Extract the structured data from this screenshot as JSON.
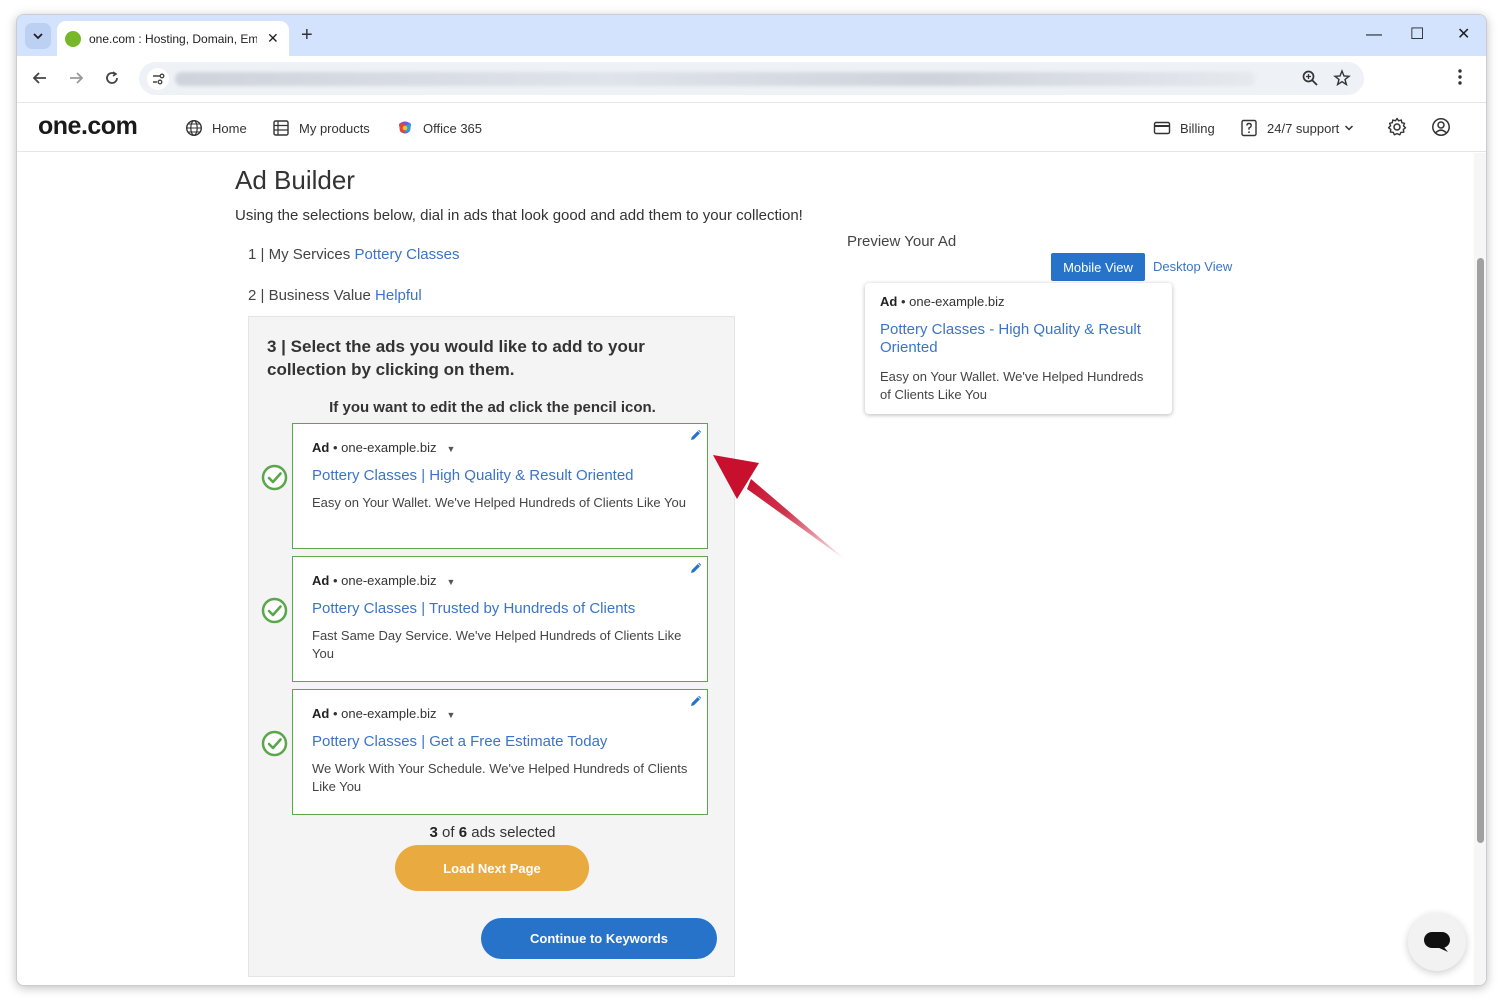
{
  "browser": {
    "tab_title": "one.com : Hosting, Domain, Em",
    "new_tab_glyph": "+",
    "close_glyph": "✕",
    "minimize_glyph": "—",
    "maximize_glyph": "☐",
    "window_close_glyph": "✕"
  },
  "site_header": {
    "logo": "one.com",
    "nav": [
      {
        "label": "Home",
        "icon": "globe-icon"
      },
      {
        "label": "My products",
        "icon": "list-icon"
      },
      {
        "label": "Office 365",
        "icon": "office-icon"
      }
    ],
    "billing_label": "Billing",
    "support_label": "24/7 support"
  },
  "page": {
    "title": "Ad Builder",
    "subtitle": "Using the selections below, dial in ads that look good and add them to your collection!",
    "step1_prefix": "1 | My Services",
    "step1_value": "Pottery Classes",
    "step2_prefix": "2 | Business Value",
    "step2_value": "Helpful"
  },
  "preview": {
    "label": "Preview Your Ad",
    "mobile_view": "Mobile View",
    "desktop_view": "Desktop View",
    "ad_tag": "Ad",
    "domain": "one-example.biz",
    "headline": "Pottery Classes - High Quality & Result Oriented",
    "description": "Easy on Your Wallet. We've Helped Hundreds of Clients Like You"
  },
  "select_panel": {
    "title": "3 | Select the ads you would like to add to your collection by clicking on them.",
    "hint": "If you want to edit the ad click the pencil icon.",
    "ads": [
      {
        "ad_tag": "Ad",
        "domain": "one-example.biz",
        "headline": "Pottery Classes | High Quality & Result Oriented",
        "description": "Easy on Your Wallet. We've Helped Hundreds of Clients Like You",
        "selected": true
      },
      {
        "ad_tag": "Ad",
        "domain": "one-example.biz",
        "headline": "Pottery Classes | Trusted by Hundreds of Clients",
        "description": "Fast Same Day Service. We've Helped Hundreds of Clients Like You",
        "selected": true
      },
      {
        "ad_tag": "Ad",
        "domain": "one-example.biz",
        "headline": "Pottery Classes | Get a Free Estimate Today",
        "description": "We Work With Your Schedule. We've Helped Hundreds of Clients Like You",
        "selected": true
      }
    ],
    "selected_count": "3",
    "count_of": "of",
    "total_count": "6",
    "count_suffix": "ads selected",
    "load_next_label": "Load Next Page",
    "continue_label": "Continue to Keywords"
  },
  "colors": {
    "primary_blue": "#2673c9",
    "link_blue": "#3b74c7",
    "selected_green": "#5aa64a",
    "load_orange": "#e9aa3f",
    "arrow_red": "#c8102e"
  }
}
